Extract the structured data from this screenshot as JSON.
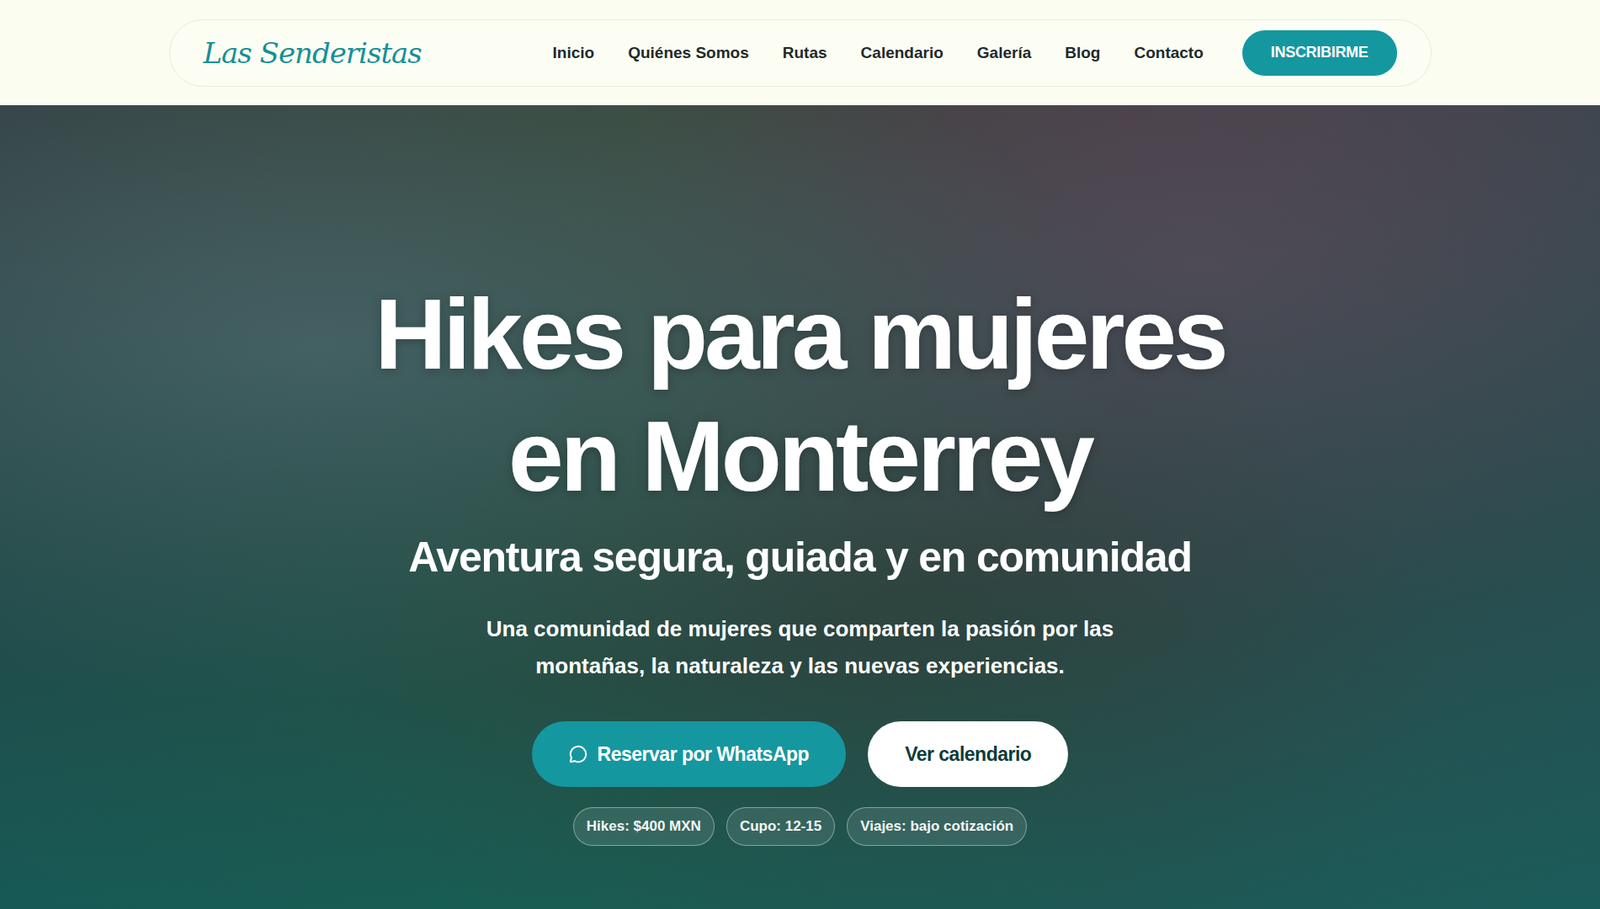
{
  "header": {
    "logo": "Las Senderistas",
    "nav": [
      {
        "label": "Inicio"
      },
      {
        "label": "Quiénes Somos"
      },
      {
        "label": "Rutas"
      },
      {
        "label": "Calendario"
      },
      {
        "label": "Galería"
      },
      {
        "label": "Blog"
      },
      {
        "label": "Contacto"
      }
    ],
    "cta": "INSCRIBIRME"
  },
  "hero": {
    "title_lines": [
      "Hikes para mujeres",
      "en Monterrey"
    ],
    "subtitle": "Aventura segura, guiada y en comunidad",
    "description": "Una comunidad de mujeres que comparten la pasión por las montañas, la naturaleza y las nuevas experiencias.",
    "buttons": [
      {
        "label": "Reservar por WhatsApp",
        "kind": "primary"
      },
      {
        "label": "Ver calendario",
        "kind": "secondary"
      }
    ],
    "chips": [
      "Hikes: $400 MXN",
      "Cupo: 12-15",
      "Viajes: bajo cotización"
    ]
  }
}
